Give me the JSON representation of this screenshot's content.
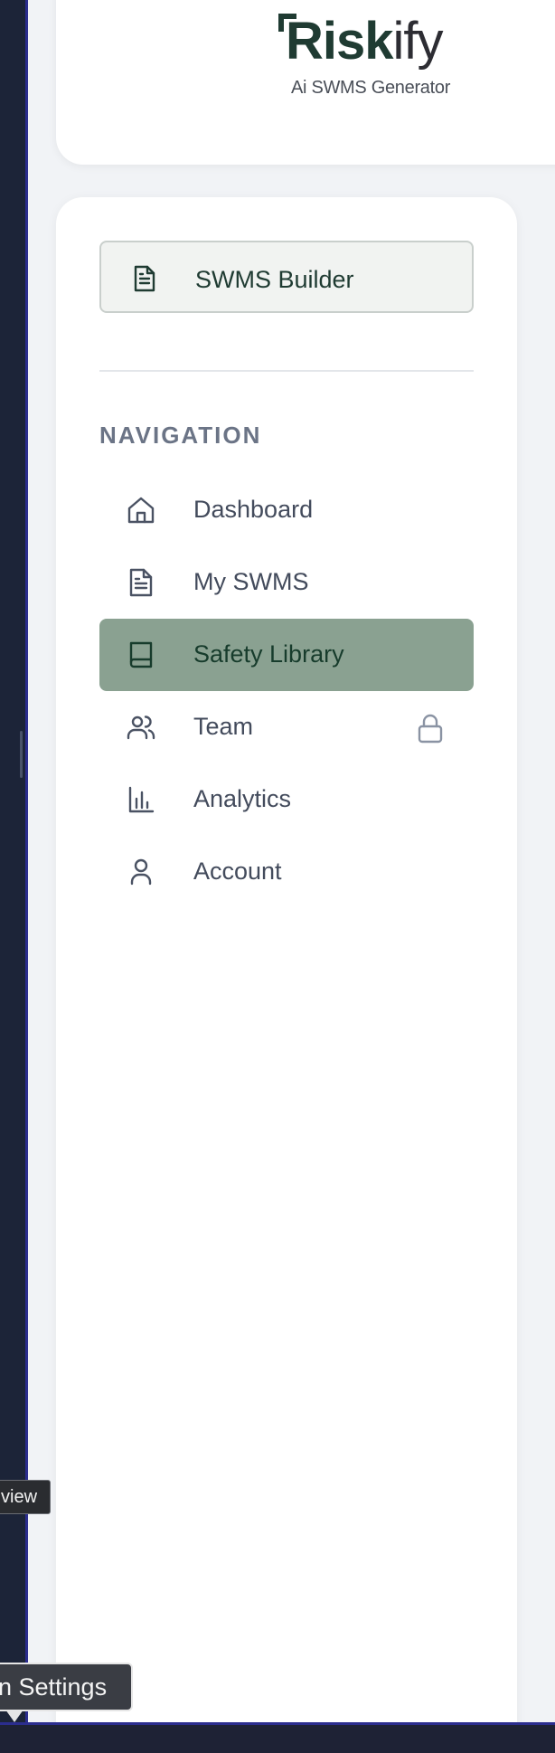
{
  "logo": {
    "name_main": "Risk",
    "name_suffix": "ify",
    "tagline": "Ai SWMS Generator",
    "brand_color": "#1f3b32"
  },
  "sidebar": {
    "primary_button": {
      "label": "SWMS Builder",
      "icon": "document-icon"
    },
    "heading": "NAVIGATION",
    "items": [
      {
        "label": "Dashboard",
        "icon": "home-icon",
        "active": false,
        "locked": false
      },
      {
        "label": "My SWMS",
        "icon": "document-icon",
        "active": false,
        "locked": false
      },
      {
        "label": "Safety Library",
        "icon": "book-icon",
        "active": true,
        "locked": false
      },
      {
        "label": "Team",
        "icon": "users-icon",
        "active": false,
        "locked": true
      },
      {
        "label": "Analytics",
        "icon": "bar-chart-icon",
        "active": false,
        "locked": false
      },
      {
        "label": "Account",
        "icon": "user-icon",
        "active": false,
        "locked": false
      }
    ],
    "active_color": "#8aa191"
  },
  "tooltips": {
    "overview": "view",
    "settings": "n Settings"
  }
}
